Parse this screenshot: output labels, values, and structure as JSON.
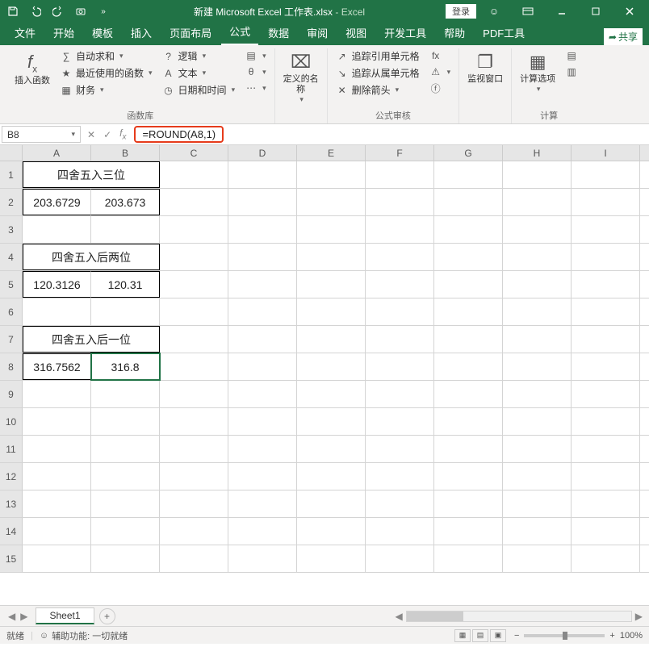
{
  "titlebar": {
    "filename": "新建 Microsoft Excel 工作表.xlsx",
    "app": "Excel",
    "login": "登录"
  },
  "tabs": {
    "file": "文件",
    "home": "开始",
    "templates": "模板",
    "insert": "插入",
    "layout": "页面布局",
    "formulas": "公式",
    "data": "数据",
    "review": "审阅",
    "view": "视图",
    "developer": "开发工具",
    "help": "帮助",
    "pdf": "PDF工具",
    "share": "共享"
  },
  "ribbon": {
    "insert_fn": "插入函数",
    "autosum": "自动求和",
    "recent": "最近使用的函数",
    "financial": "财务",
    "logical": "逻辑",
    "text": "文本",
    "datetime": "日期和时间",
    "group_function": "函数库",
    "define_name": "定义的名称",
    "trace_prec": "追踪引用单元格",
    "trace_dep": "追踪从属单元格",
    "remove_arrows": "删除箭头",
    "group_audit": "公式审核",
    "watch": "监视窗口",
    "calc_options": "计算选项",
    "group_calc": "计算"
  },
  "namebox": {
    "value": "B8"
  },
  "formula": {
    "value": "=ROUND(A8,1)"
  },
  "columns": [
    "A",
    "B",
    "C",
    "D",
    "E",
    "F",
    "G",
    "H",
    "I"
  ],
  "sheet": {
    "r1": {
      "merged": "四舍五入三位"
    },
    "r2": {
      "a": "203.6729",
      "b": "203.673"
    },
    "r4": {
      "merged": "四舍五入后两位"
    },
    "r5": {
      "a": "120.3126",
      "b": "120.31"
    },
    "r7": {
      "merged": "四舍五入后一位"
    },
    "r8": {
      "a": "316.7562",
      "b": "316.8"
    }
  },
  "sheetTab": "Sheet1",
  "status": {
    "ready": "就绪",
    "access": "辅助功能: 一切就绪",
    "zoom": "100%"
  }
}
